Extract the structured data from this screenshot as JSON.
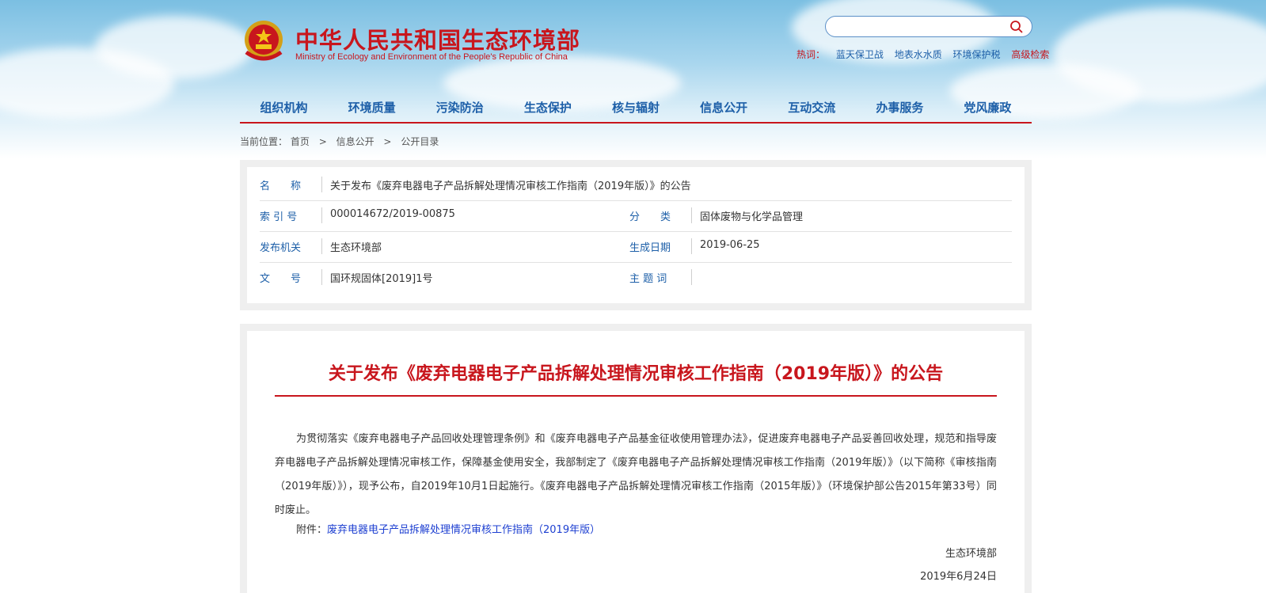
{
  "header": {
    "site_title": "中华人民共和国生态环境部",
    "site_subtitle": "Ministry of Ecology and Environment of the People's Republic of China",
    "search_placeholder": "",
    "hotwords_label": "热词：",
    "hotwords": [
      "蓝天保卫战",
      "地表水水质",
      "环境保护税"
    ],
    "advanced_search": "高级检索"
  },
  "nav": {
    "items": [
      "组织机构",
      "环境质量",
      "污染防治",
      "生态保护",
      "核与辐射",
      "信息公开",
      "互动交流",
      "办事服务",
      "党风廉政"
    ]
  },
  "breadcrumb": {
    "label": "当前位置：",
    "home": "首页",
    "sep": ">",
    "level1": "信息公开",
    "level2": "公开目录"
  },
  "info": {
    "name_label": "名　　称",
    "name_value": "关于发布《废弃电器电子产品拆解处理情况审核工作指南（2019年版）》的公告",
    "index_label": "索 引 号",
    "index_value": "000014672/2019-00875",
    "category_label": "分　　类",
    "category_value": "固体废物与化学品管理",
    "issuer_label": "发布机关",
    "issuer_value": "生态环境部",
    "date_label": "生成日期",
    "date_value": "2019-06-25",
    "docno_label": "文　　号",
    "docno_value": "国环规固体[2019]1号",
    "subject_label": "主 题 词",
    "subject_value": ""
  },
  "article": {
    "title": "关于发布《废弃电器电子产品拆解处理情况审核工作指南（2019年版）》的公告",
    "body": "为贯彻落实《废弃电器电子产品回收处理管理条例》和《废弃电器电子产品基金征收使用管理办法》，促进废弃电器电子产品妥善回收处理，规范和指导废弃电器电子产品拆解处理情况审核工作，保障基金使用安全，我部制定了《废弃电器电子产品拆解处理情况审核工作指南（2019年版）》（以下简称《审核指南（2019年版）》），现予公布，自2019年10月1日起施行。《废弃电器电子产品拆解处理情况审核工作指南（2015年版）》（环境保护部公告2015年第33号）同时废止。",
    "attachment_label": "附件：",
    "attachment_link": "废弃电器电子产品拆解处理情况审核工作指南（2019年版）",
    "signer": "生态环境部",
    "sign_date": "2019年6月24日"
  },
  "colors": {
    "brand_red": "#c8161d",
    "link_blue": "#1d5fa8",
    "attachment_blue": "#1d3fd1"
  },
  "icons": {
    "emblem": "national-emblem-icon",
    "search": "search-icon"
  }
}
